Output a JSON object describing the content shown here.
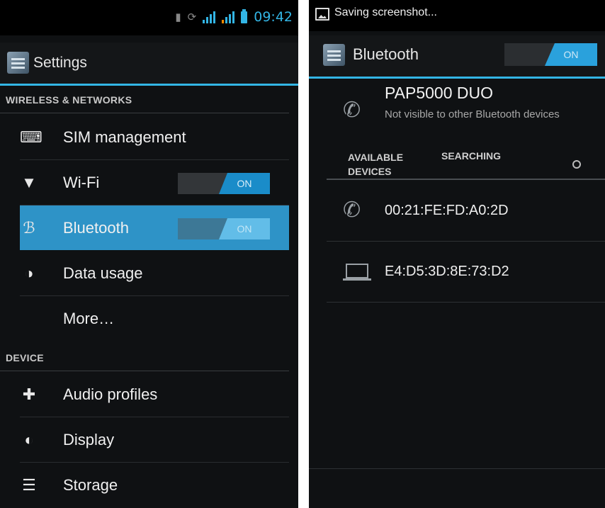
{
  "left": {
    "status": {
      "time": "09:42"
    },
    "title": "Settings",
    "sections": {
      "wireless": "WIRELESS & NETWORKS",
      "device": "DEVICE"
    },
    "items": {
      "sim": "SIM management",
      "wifi": "Wi-Fi",
      "wifi_toggle": "ON",
      "bluetooth": "Bluetooth",
      "bluetooth_toggle": "ON",
      "data": "Data usage",
      "more": "More…",
      "audio": "Audio profiles",
      "display": "Display",
      "storage": "Storage"
    }
  },
  "right": {
    "notification": "Saving screenshot...",
    "title": "Bluetooth",
    "toggle": "ON",
    "device_name": "PAP5000 DUO",
    "device_subtitle": "Not visible to other Bluetooth devices",
    "available_label": "AVAILABLE DEVICES",
    "searching_label": "SEARCHING",
    "devices": [
      {
        "address": "00:21:FE:FD:A0:2D",
        "icon": "phone-icon"
      },
      {
        "address": "E4:D5:3D:8E:73:D2",
        "icon": "laptop-icon"
      }
    ]
  },
  "colors": {
    "accent": "#33b5e5",
    "selected_row": "#2e93c7",
    "background": "#0f1113"
  }
}
